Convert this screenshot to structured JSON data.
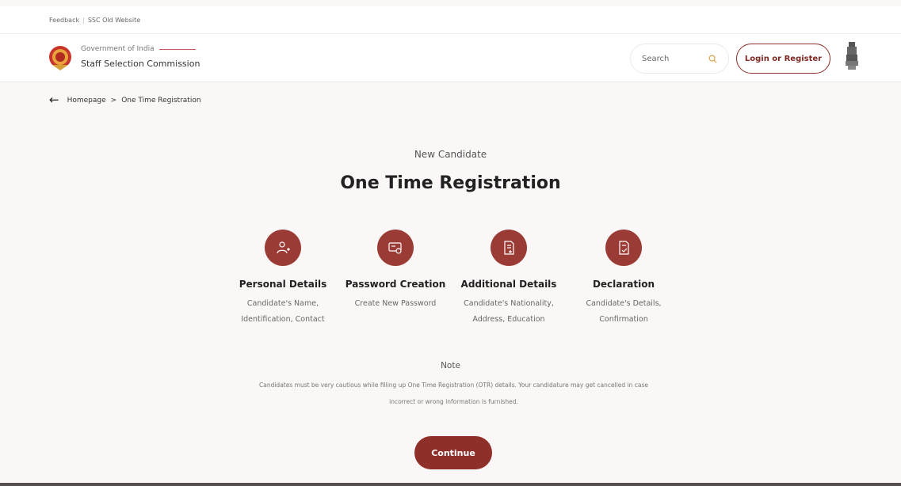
{
  "topbar": {
    "feedback": "Feedback",
    "old_website": "SSC Old Website"
  },
  "header": {
    "gov_text": "Government of India",
    "org_name": "Staff Selection Commission",
    "search_placeholder": "Search",
    "login_label": "Login or Register"
  },
  "breadcrumb": {
    "home": "Homepage",
    "separator": ">",
    "current": "One Time Registration"
  },
  "main": {
    "subtitle": "New Candidate",
    "title": "One Time Registration"
  },
  "steps": [
    {
      "icon": "user-plus-icon",
      "title": "Personal Details",
      "desc": "Candidate's Name, Identification, Contact"
    },
    {
      "icon": "password-icon",
      "title": "Password Creation",
      "desc": "Create New Password"
    },
    {
      "icon": "document-add-icon",
      "title": "Additional Details",
      "desc": "Candidate's Nationality, Address, Education"
    },
    {
      "icon": "document-check-icon",
      "title": "Declaration",
      "desc": "Candidate's Details, Confirmation"
    }
  ],
  "note": {
    "title": "Note",
    "text": "Candidates must be very cautious while filling up One Time Registration (OTR) details. Your candidature may get cancelled in case incorrect or wrong information is furnished."
  },
  "continue_label": "Continue",
  "colors": {
    "brand_maroon": "#8e2f2a",
    "background": "#fbf7f6"
  }
}
